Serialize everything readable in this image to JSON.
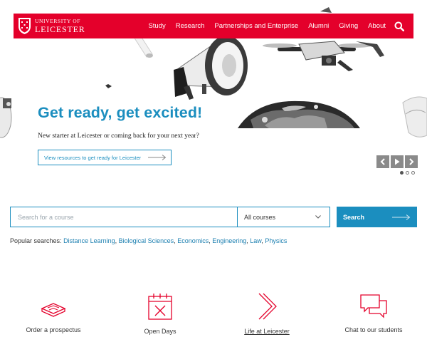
{
  "brand": {
    "line1": "UNIVERSITY OF",
    "line2": "LEICESTER",
    "color": "#e4002b"
  },
  "nav": {
    "items": [
      {
        "label": "Study"
      },
      {
        "label": "Research"
      },
      {
        "label": "Partnerships and Enterprise"
      },
      {
        "label": "Alumni"
      },
      {
        "label": "Giving"
      },
      {
        "label": "About"
      }
    ],
    "search_icon": "search-icon"
  },
  "hero": {
    "title": "Get ready, get excited!",
    "subtitle": "New starter at Leicester or coming back for your next year?",
    "cta_label": "View resources to get ready for Leicester",
    "accent": "#1b8ebf",
    "slides_total": 3,
    "active_slide": 1
  },
  "course_search": {
    "placeholder": "Search for a course",
    "select_value": "All courses",
    "button_label": "Search"
  },
  "popular": {
    "prefix": "Popular searches:",
    "links": [
      "Distance Learning",
      "Biological Sciences",
      "Economics",
      "Engineering",
      "Law",
      "Physics"
    ]
  },
  "quick_links": [
    {
      "label": "Order a prospectus",
      "icon": "prospectus-book-icon"
    },
    {
      "label": "Open Days",
      "icon": "calendar-icon"
    },
    {
      "label": "Life at Leicester",
      "icon": "chevron-right-icon"
    },
    {
      "label": "Chat to our students",
      "icon": "chat-bubbles-icon"
    }
  ]
}
